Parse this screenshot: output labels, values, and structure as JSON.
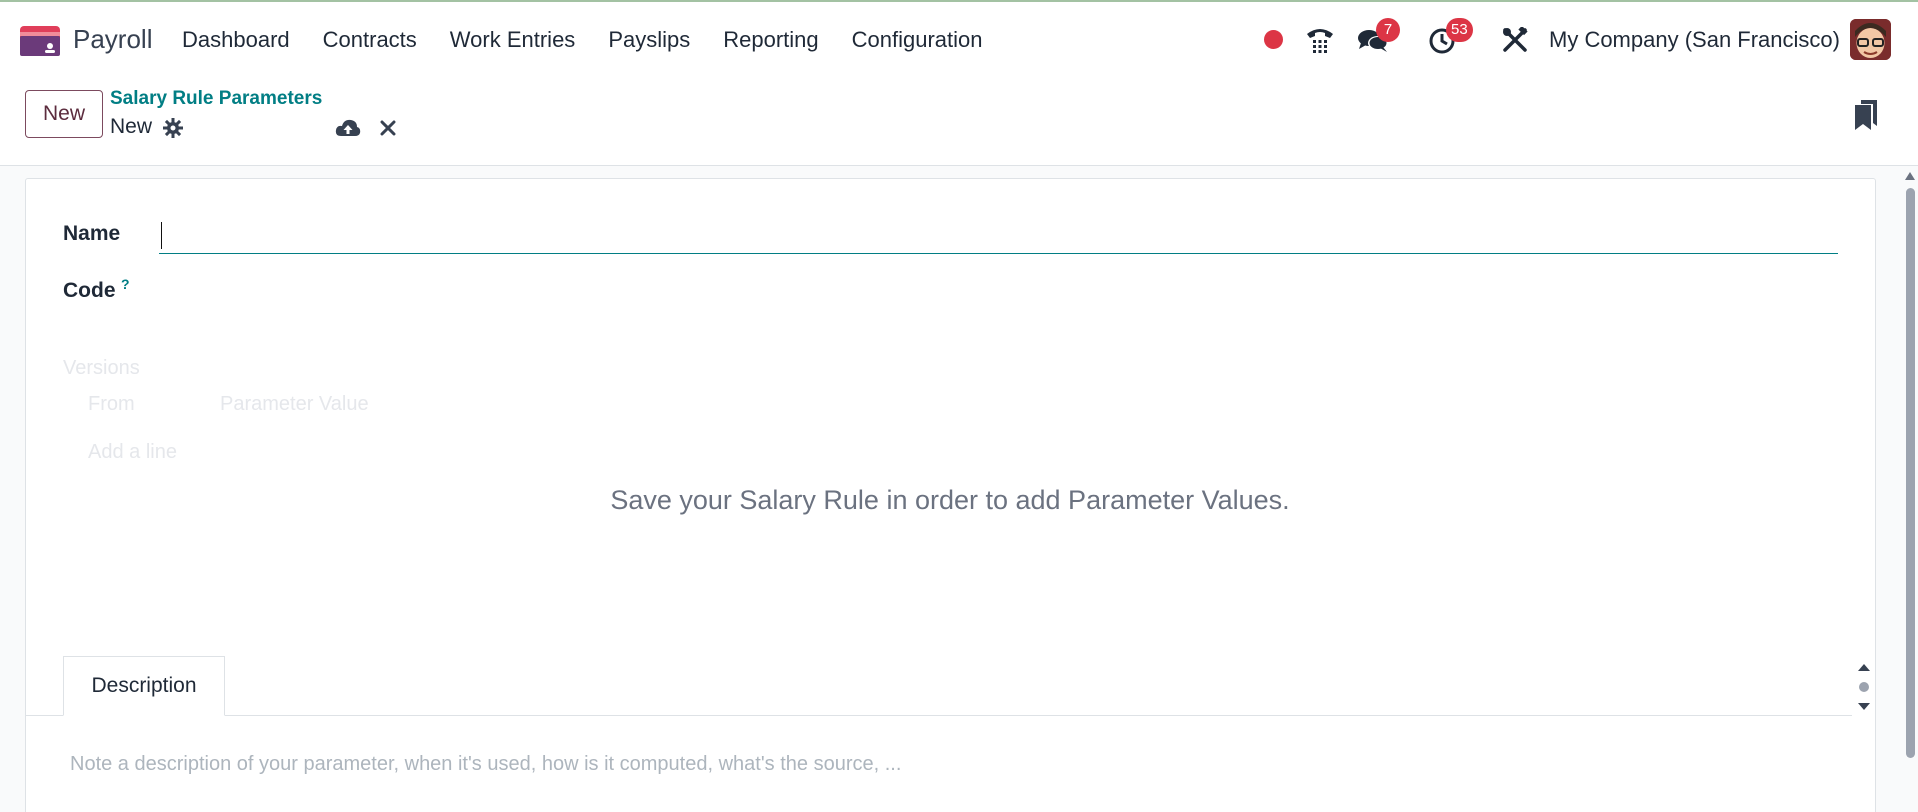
{
  "app": {
    "name": "Payroll"
  },
  "menu": {
    "items": [
      "Dashboard",
      "Contracts",
      "Work Entries",
      "Payslips",
      "Reporting",
      "Configuration"
    ]
  },
  "systray": {
    "messages_count": "7",
    "activities_count": "53",
    "company": "My Company (San Francisco)"
  },
  "control_panel": {
    "new_label": "New",
    "breadcrumb": "Salary Rule Parameters",
    "record": "New"
  },
  "form": {
    "name_label": "Name",
    "name_value": "",
    "code_label": "Code",
    "code_help": "?",
    "versions_label": "Versions",
    "col_from": "From",
    "col_value": "Parameter Value",
    "add_line": "Add a line",
    "helper": "Save your Salary Rule in order to add Parameter Values."
  },
  "tabs": {
    "description": "Description",
    "description_placeholder": "Note a description of your parameter, when it's used, how is it computed, what's the source, ..."
  },
  "colors": {
    "brand": "#714b67",
    "link": "#017e84",
    "badge": "#dc3545"
  }
}
